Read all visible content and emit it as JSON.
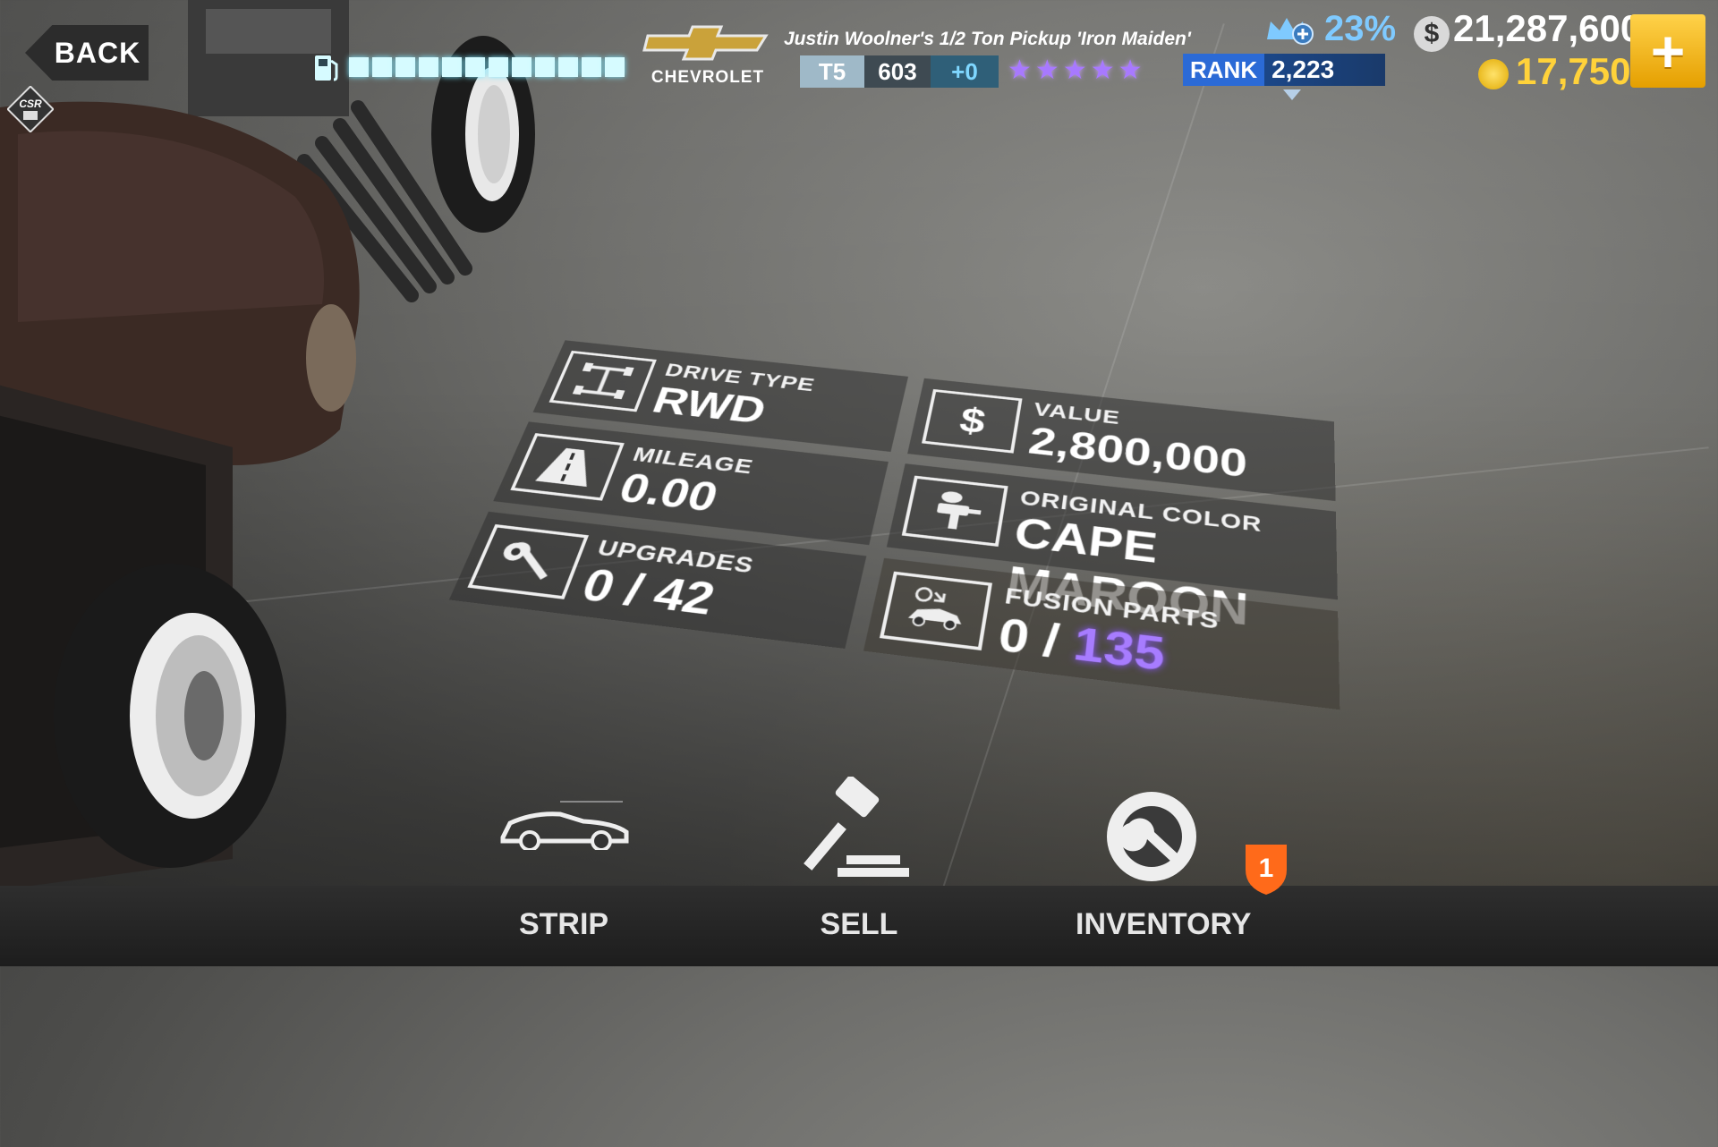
{
  "header": {
    "back_label": "BACK",
    "fuel_segments": 12,
    "brand_name": "CHEVROLET",
    "car_name": "Justin Woolner's 1/2 Ton Pickup 'Iron Maiden'",
    "tier": "T5",
    "performance_points": "603",
    "performance_bonus": "+0",
    "star_rating": 5,
    "crew_percent": "23%",
    "rank_label": "RANK",
    "rank_value": "2,223",
    "cash": "21,287,600",
    "gold": "17,750",
    "add_label": "+"
  },
  "stats": {
    "drive_type": {
      "label": "DRIVE TYPE",
      "value": "RWD"
    },
    "mileage": {
      "label": "MILEAGE",
      "value": "0.00"
    },
    "upgrades": {
      "label": "UPGRADES",
      "value": "0 / 42"
    },
    "value": {
      "label": "VALUE",
      "value": "2,800,000"
    },
    "original_color": {
      "label": "ORIGINAL COLOR",
      "value": "CAPE MAROON"
    },
    "fusion_parts": {
      "label": "FUSION PARTS",
      "value_prefix": "0 / ",
      "value_total": "135"
    }
  },
  "actions": {
    "strip": "STRIP",
    "sell": "SELL",
    "inventory": "INVENTORY",
    "inventory_badge": "1"
  },
  "colors": {
    "accent_blue": "#7fcaff",
    "gold": "#ffd23a",
    "star_purple": "#a879ff",
    "badge_orange": "#ff6a1a"
  }
}
